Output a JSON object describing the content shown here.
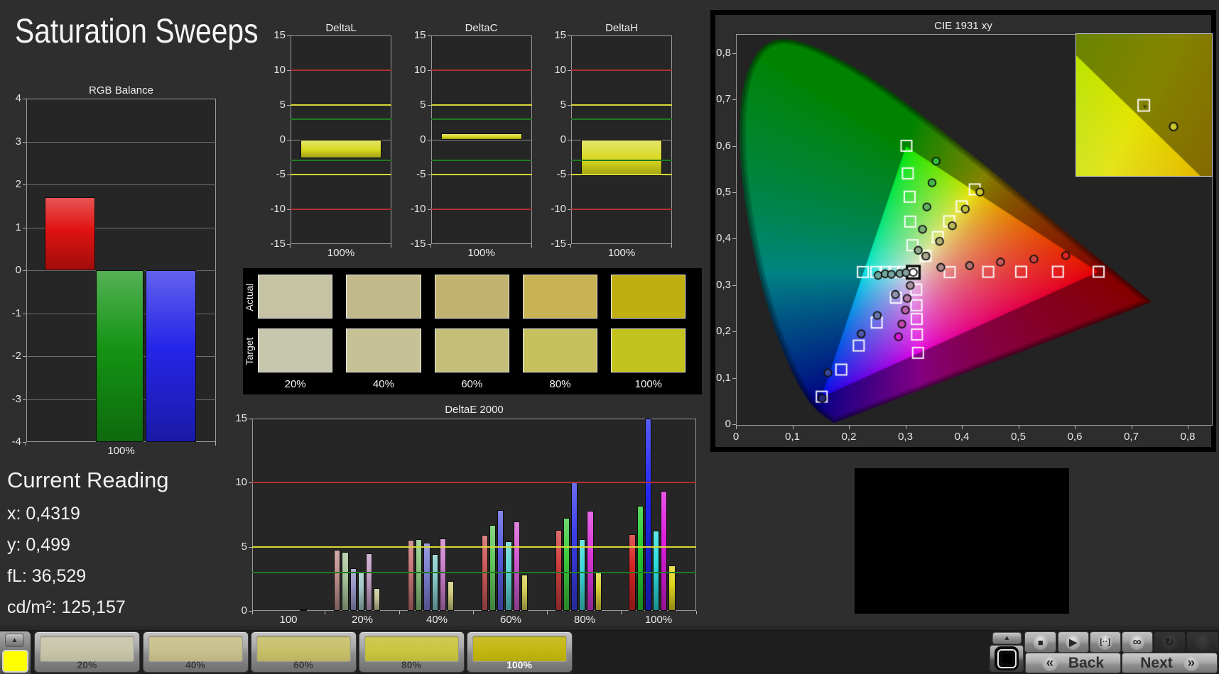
{
  "page": {
    "title": "Saturation Sweeps",
    "background": "#2e2e2e",
    "accent_sweep_color": "yellow"
  },
  "current_reading": {
    "heading": "Current Reading",
    "lines": [
      "x: 0,4319",
      "y: 0,499",
      "fL: 36,529",
      "cd/m²: 125,157"
    ]
  },
  "chart_data": [
    {
      "id": "rgb_balance",
      "type": "bar",
      "title": "RGB Balance",
      "categories": [
        "100%"
      ],
      "xlabel": "100%",
      "ylim": [
        -4,
        4
      ],
      "yticks": [
        -4,
        -3,
        -2,
        -1,
        0,
        1,
        2,
        3,
        4
      ],
      "grid": true,
      "series": [
        {
          "name": "Red",
          "color": "#e01212",
          "value": 1.7
        },
        {
          "name": "Green",
          "color": "#149414",
          "value": -4.0
        },
        {
          "name": "Blue",
          "color": "#2525e8",
          "value": -4.0
        }
      ]
    },
    {
      "id": "deltaL",
      "type": "bar",
      "title": "DeltaL",
      "xlabel": "100%",
      "ylim": [
        -15,
        15
      ],
      "yticks": [
        -15,
        -10,
        -5,
        0,
        5,
        10,
        15
      ],
      "ref_lines": [
        {
          "v": 10,
          "color": "#b23232"
        },
        {
          "v": -10,
          "color": "#b23232"
        },
        {
          "v": 5,
          "color": "#d8d838"
        },
        {
          "v": -5,
          "color": "#d8d838"
        },
        {
          "v": 3,
          "color": "#217a21"
        },
        {
          "v": -3,
          "color": "#217a21"
        }
      ],
      "values": [
        -2.6
      ],
      "bar_color": "#d8d81e"
    },
    {
      "id": "deltaC",
      "type": "bar",
      "title": "DeltaC",
      "xlabel": "100%",
      "ylim": [
        -15,
        15
      ],
      "yticks": [
        -15,
        -10,
        -5,
        0,
        5,
        10,
        15
      ],
      "ref_lines": [
        {
          "v": 10,
          "color": "#b23232"
        },
        {
          "v": -10,
          "color": "#b23232"
        },
        {
          "v": 5,
          "color": "#d8d838"
        },
        {
          "v": -5,
          "color": "#d8d838"
        },
        {
          "v": 3,
          "color": "#217a21"
        },
        {
          "v": -3,
          "color": "#217a21"
        }
      ],
      "values": [
        0.9
      ],
      "bar_color": "#d8d81e"
    },
    {
      "id": "deltaH",
      "type": "bar",
      "title": "DeltaH",
      "xlabel": "100%",
      "ylim": [
        -15,
        15
      ],
      "yticks": [
        -15,
        -10,
        -5,
        0,
        5,
        10,
        15
      ],
      "ref_lines": [
        {
          "v": 10,
          "color": "#b23232"
        },
        {
          "v": -10,
          "color": "#b23232"
        },
        {
          "v": 5,
          "color": "#d8d838"
        },
        {
          "v": -5,
          "color": "#d8d838"
        },
        {
          "v": 3,
          "color": "#217a21"
        },
        {
          "v": -3,
          "color": "#217a21"
        }
      ],
      "values": [
        -5.2
      ],
      "bar_color": "#d8d81e"
    },
    {
      "id": "deltaE2000",
      "type": "bar",
      "title": "DeltaE 2000",
      "ylim": [
        0,
        15
      ],
      "yticks": [
        0,
        5,
        10,
        15
      ],
      "ref_lines": [
        {
          "v": 10,
          "color": "#b23232"
        },
        {
          "v": 5,
          "color": "#d8d838"
        },
        {
          "v": 3,
          "color": "#217a21"
        }
      ],
      "categories": [
        "100",
        "20%",
        "40%",
        "60%",
        "80%",
        "100%"
      ],
      "groups": [
        {
          "label": "100",
          "values": [
            0,
            0,
            0,
            0,
            0,
            0.15
          ],
          "colors": [
            "#141414",
            "#141414",
            "#141414",
            "#141414",
            "#141414",
            "#141414"
          ]
        },
        {
          "label": "20%",
          "values": [
            4.75,
            4.6,
            3.3,
            3.0,
            4.5,
            1.8
          ],
          "colors": [
            "#c09090",
            "#a9c49b",
            "#9899c9",
            "#a2c6c6",
            "#c3a0c6",
            "#c9c79b"
          ]
        },
        {
          "label": "40%",
          "values": [
            5.55,
            5.6,
            5.3,
            4.45,
            5.65,
            2.3
          ],
          "colors": [
            "#c77676",
            "#8cc47f",
            "#7d7fd2",
            "#86cccc",
            "#cb7fcb",
            "#cfcb7e"
          ]
        },
        {
          "label": "60%",
          "values": [
            5.9,
            6.7,
            7.85,
            5.4,
            6.95,
            2.8
          ],
          "colors": [
            "#cd5a5a",
            "#63c95e",
            "#5b5ee0",
            "#5fd3d3",
            "#d45cd4",
            "#d6cf58"
          ]
        },
        {
          "label": "80%",
          "values": [
            6.3,
            7.25,
            10.0,
            5.6,
            7.8,
            3.05
          ],
          "colors": [
            "#d23f3f",
            "#3fcc3f",
            "#3a3eea",
            "#3fd9d9",
            "#dc39dc",
            "#dcd238"
          ]
        },
        {
          "label": "100%",
          "values": [
            6.0,
            8.2,
            15.0,
            6.25,
            9.35,
            3.55
          ],
          "colors": [
            "#d62525",
            "#25cd2f",
            "#2226f2",
            "#2edede",
            "#e01ee0",
            "#e0d51e"
          ]
        }
      ]
    },
    {
      "id": "cie1931",
      "type": "scatter",
      "title": "CIE 1931 xy",
      "xlim": [
        0,
        0.8415
      ],
      "ylim": [
        0,
        0.841
      ],
      "xticks": [
        "0",
        "0,1",
        "0,2",
        "0,3",
        "0,4",
        "0,5",
        "0,6",
        "0,7",
        "0,8"
      ],
      "yticks": [
        "0",
        "0,1",
        "0,2",
        "0,3",
        "0,4",
        "0,5",
        "0,6",
        "0,7",
        "0,8"
      ],
      "gamut_triangle": [
        [
          0.64,
          0.33
        ],
        [
          0.3,
          0.6
        ],
        [
          0.15,
          0.06
        ]
      ],
      "white_point": [
        0.3127,
        0.329
      ],
      "targets": {
        "red": [
          [
            0.3773,
            0.3294
          ],
          [
            0.4455,
            0.33
          ],
          [
            0.5037,
            0.3303
          ],
          [
            0.5688,
            0.3303
          ],
          [
            0.641,
            0.3302
          ]
        ],
        "green": [
          [
            0.3114,
            0.3874
          ],
          [
            0.3073,
            0.4383
          ],
          [
            0.3063,
            0.4919
          ],
          [
            0.3031,
            0.5422
          ],
          [
            0.3006,
            0.6017
          ]
        ],
        "blue": [
          [
            0.282,
            0.2743
          ],
          [
            0.248,
            0.2207
          ],
          [
            0.2162,
            0.1711
          ],
          [
            0.1853,
            0.1193
          ],
          [
            0.1506,
            0.061
          ]
        ],
        "cyan": [
          [
            0.295,
            0.3297
          ],
          [
            0.2791,
            0.3297
          ],
          [
            0.2633,
            0.3297
          ],
          [
            0.2473,
            0.3297
          ],
          [
            0.2235,
            0.3297
          ]
        ],
        "magenta": [
          [
            0.318,
            0.2917
          ],
          [
            0.3184,
            0.258
          ],
          [
            0.3188,
            0.2284
          ],
          [
            0.3193,
            0.195
          ],
          [
            0.3211,
            0.1554
          ]
        ],
        "yellow": [
          [
            0.3346,
            0.3642
          ],
          [
            0.3562,
            0.4051
          ],
          [
            0.3762,
            0.4391
          ],
          [
            0.3985,
            0.4711
          ],
          [
            0.4216,
            0.5078
          ]
        ]
      },
      "measurements": {
        "red": {
          "points": [
            [
              0.3616,
              0.3398
            ],
            [
              0.4125,
              0.3436
            ],
            [
              0.4672,
              0.3512
            ],
            [
              0.5263,
              0.3575
            ],
            [
              0.5827,
              0.3652
            ]
          ],
          "colors": [
            "#ad8a8a",
            "#b77272",
            "#c25a5a",
            "#cc4242",
            "#e02222"
          ]
        },
        "green": {
          "points": [
            [
              0.3215,
              0.3765
            ],
            [
              0.3291,
              0.4217
            ],
            [
              0.3368,
              0.4699
            ],
            [
              0.346,
              0.522
            ],
            [
              0.3531,
              0.5685
            ]
          ],
          "colors": [
            "#92a98c",
            "#79ae77",
            "#5fb360",
            "#45b94b",
            "#2abf37"
          ]
        },
        "blue": {
          "points": [
            [
              0.281,
              0.2813
            ],
            [
              0.249,
              0.2361
            ],
            [
              0.2205,
              0.1965
            ],
            [
              0.1617,
              0.1125
            ],
            [
              0.1515,
              0.057
            ]
          ],
          "colors": [
            "#8e93b2",
            "#6a74ac",
            "#4f5ba5",
            "#3a4694",
            "#232a7a"
          ]
        },
        "cyan": {
          "points": [
            [
              0.2505,
              0.3226
            ],
            [
              0.263,
              0.3257
            ],
            [
              0.274,
              0.3246
            ],
            [
              0.289,
              0.3264
            ],
            [
              0.3,
              0.3281
            ]
          ],
          "colors": [
            "#68a89f",
            "#6fa79e",
            "#76a59d",
            "#7da49c",
            "#84a29b"
          ]
        },
        "magenta": {
          "points": [
            [
              0.3074,
              0.3006
            ],
            [
              0.302,
              0.2728
            ],
            [
              0.2988,
              0.2477
            ],
            [
              0.2925,
              0.2175
            ],
            [
              0.2866,
              0.1901
            ]
          ],
          "colors": [
            "#ab93a3",
            "#b27aa6",
            "#ba60aa",
            "#c346ae",
            "#d818d8"
          ]
        },
        "yellow": {
          "points": [
            [
              0.335,
              0.3641
            ],
            [
              0.3593,
              0.3957
            ],
            [
              0.3818,
              0.4294
            ],
            [
              0.4048,
              0.4653
            ],
            [
              0.4308,
              0.502
            ]
          ],
          "colors": [
            "#a8a88e",
            "#b0b070",
            "#b9b958",
            "#c1c140",
            "#c9c928"
          ]
        },
        "white": {
          "points": [
            [
              0.3127,
              0.329
            ]
          ],
          "colors": [
            "#ffffff"
          ]
        }
      },
      "inset": {
        "viewport": {
          "x": [
            0.3987,
            0.4447
          ],
          "y": [
            0.4882,
            0.5276
          ]
        },
        "target": [
          0.4216,
          0.5078
        ],
        "measurement": [
          0.4317,
          0.5019
        ],
        "measurement_color": "#c6c62a"
      },
      "spectral_locus": [
        [
          0.1741,
          0.005
        ],
        [
          0.174,
          0.005
        ],
        [
          0.1738,
          0.0049
        ],
        [
          0.1736,
          0.0049
        ],
        [
          0.1733,
          0.0048
        ],
        [
          0.173,
          0.0048
        ],
        [
          0.1726,
          0.0048
        ],
        [
          0.1721,
          0.0048
        ],
        [
          0.1714,
          0.0051
        ],
        [
          0.1703,
          0.0058
        ],
        [
          0.1689,
          0.0069
        ],
        [
          0.1669,
          0.0086
        ],
        [
          0.1644,
          0.0109
        ],
        [
          0.1611,
          0.0138
        ],
        [
          0.1566,
          0.0177
        ],
        [
          0.151,
          0.0227
        ],
        [
          0.144,
          0.0297
        ],
        [
          0.1355,
          0.0399
        ],
        [
          0.1241,
          0.0578
        ],
        [
          0.1096,
          0.0868
        ],
        [
          0.0913,
          0.1327
        ],
        [
          0.0687,
          0.2007
        ],
        [
          0.0454,
          0.295
        ],
        [
          0.0235,
          0.4127
        ],
        [
          0.0082,
          0.5384
        ],
        [
          0.0039,
          0.6548
        ],
        [
          0.0139,
          0.7502
        ],
        [
          0.0389,
          0.812
        ],
        [
          0.0743,
          0.8338
        ],
        [
          0.1142,
          0.8262
        ],
        [
          0.1547,
          0.8059
        ],
        [
          0.1929,
          0.7816
        ],
        [
          0.2296,
          0.7543
        ],
        [
          0.2658,
          0.7243
        ],
        [
          0.3016,
          0.6923
        ],
        [
          0.3373,
          0.6589
        ],
        [
          0.3731,
          0.6245
        ],
        [
          0.4087,
          0.5896
        ],
        [
          0.4441,
          0.5547
        ],
        [
          0.4788,
          0.5202
        ],
        [
          0.5125,
          0.4866
        ],
        [
          0.5448,
          0.4544
        ],
        [
          0.5752,
          0.4242
        ],
        [
          0.6029,
          0.3965
        ],
        [
          0.627,
          0.3725
        ],
        [
          0.6482,
          0.3514
        ],
        [
          0.6658,
          0.334
        ],
        [
          0.6801,
          0.3197
        ],
        [
          0.6915,
          0.3083
        ],
        [
          0.7006,
          0.2993
        ],
        [
          0.7079,
          0.292
        ],
        [
          0.714,
          0.2859
        ],
        [
          0.719,
          0.2809
        ],
        [
          0.723,
          0.277
        ],
        [
          0.726,
          0.274
        ],
        [
          0.7283,
          0.2717
        ],
        [
          0.73,
          0.27
        ],
        [
          0.7311,
          0.2689
        ],
        [
          0.732,
          0.268
        ],
        [
          0.7327,
          0.2673
        ],
        [
          0.7334,
          0.2666
        ],
        [
          0.734,
          0.266
        ],
        [
          0.7344,
          0.2656
        ],
        [
          0.7346,
          0.2654
        ],
        [
          0.7347,
          0.2653
        ]
      ]
    }
  ],
  "swatch_panel": {
    "row_labels": [
      "Actual",
      "Target"
    ],
    "col_labels": [
      "20%",
      "40%",
      "60%",
      "80%",
      "100%"
    ],
    "actual_colors": [
      "#c6c2a4",
      "#c3ba8b",
      "#c3b370",
      "#c8b354",
      "#c0af10"
    ],
    "target_colors": [
      "#c7c7ae",
      "#c6c296",
      "#c4be79",
      "#c6c15e",
      "#c4c21d"
    ]
  },
  "bottom_bar": {
    "sample_swatch_color": "#ffff00",
    "slots": [
      {
        "label": "20%",
        "color": "#c8c5a9",
        "selected": false
      },
      {
        "label": "40%",
        "color": "#c7c08c",
        "selected": false
      },
      {
        "label": "60%",
        "color": "#c7bf68",
        "selected": false
      },
      {
        "label": "80%",
        "color": "#c9c53e",
        "selected": false
      },
      {
        "label": "100%",
        "color": "#c2b60e",
        "selected": true
      }
    ],
    "transport": [
      {
        "icon": "stop",
        "enabled": true
      },
      {
        "icon": "play",
        "enabled": true
      },
      {
        "icon": "bracket",
        "enabled": true
      },
      {
        "icon": "infinity",
        "enabled": true
      },
      {
        "icon": "refresh",
        "enabled": false
      },
      {
        "icon": "blank",
        "enabled": false
      }
    ],
    "back_label": "Back",
    "next_label": "Next",
    "icons": {
      "up_triangle": "▲",
      "stop": "■",
      "play": "▶",
      "bracket": "[··]",
      "infinity": "∞",
      "refresh": "↻",
      "blank": "",
      "back_chevrons": "«",
      "next_chevrons": "»"
    }
  }
}
